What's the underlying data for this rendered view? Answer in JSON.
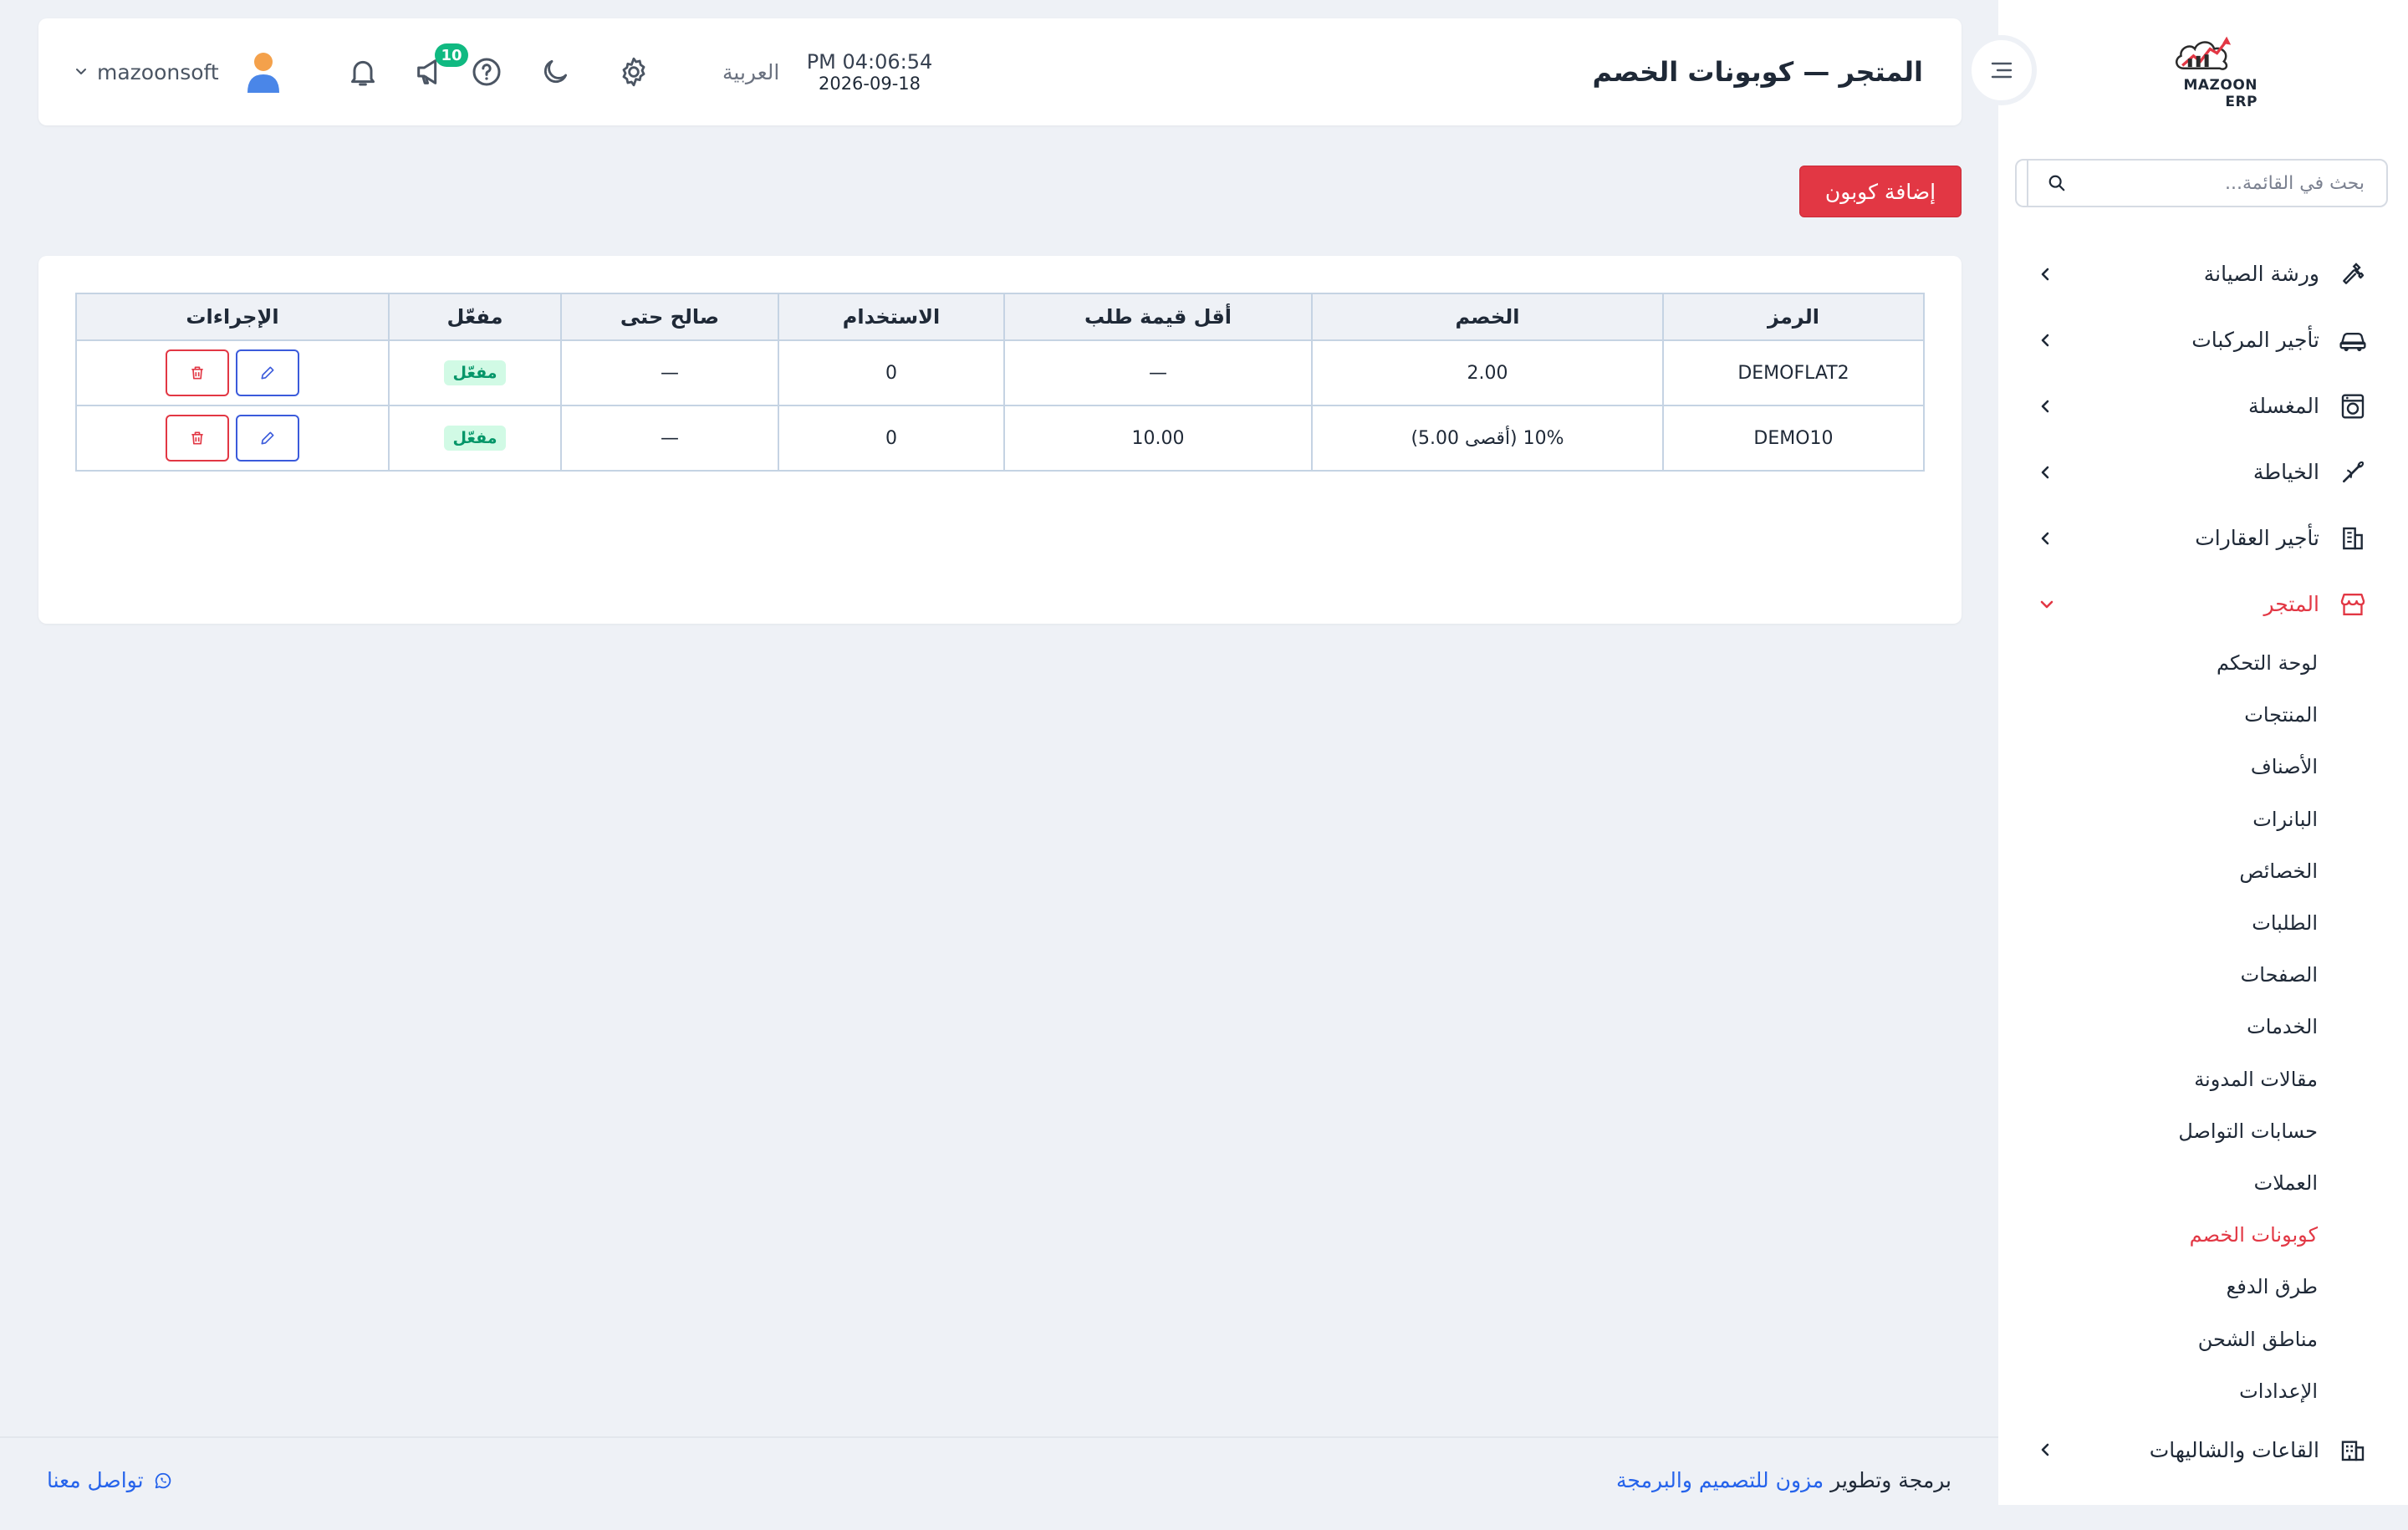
{
  "brand": {
    "logo_text": "MAZOON ERP",
    "accent": "#e23744"
  },
  "sidebar": {
    "search_placeholder": "بحث في القائمة...",
    "items": [
      {
        "label": "ورشة الصيانة",
        "icon": "wrench-icon"
      },
      {
        "label": "تأجير المركبات",
        "icon": "car-icon"
      },
      {
        "label": "المغسلة",
        "icon": "washing-machine-icon"
      },
      {
        "label": "الخياطة",
        "icon": "needle-icon"
      },
      {
        "label": "تأجير العقارات",
        "icon": "building-icon"
      },
      {
        "label": "المتجر",
        "icon": "store-icon",
        "expanded": true
      },
      {
        "label": "القاعات والشاليهات",
        "icon": "hall-icon"
      }
    ],
    "store_submenu": [
      "لوحة التحكم",
      "المنتجات",
      "الأصناف",
      "البانرات",
      "الخصائص",
      "الطلبات",
      "الصفحات",
      "الخدمات",
      "مقالات المدونة",
      "حسابات التواصل",
      "العملات",
      "كوبونات الخصم",
      "طرق الدفع",
      "مناطق الشحن",
      "الإعدادات"
    ],
    "active_submenu": "كوبونات الخصم"
  },
  "header": {
    "title": "المتجر — كوبونات الخصم",
    "time": "PM 04:06:54",
    "date": "2026-09-18",
    "language": "العربية",
    "notification_count": "10",
    "username": "mazoonsoft"
  },
  "toolbar": {
    "add_label": "إضافة كوبون"
  },
  "table": {
    "headers": [
      "الرمز",
      "الخصم",
      "أقل قيمة طلب",
      "الاستخدام",
      "صالح حتى",
      "مفعّل",
      "الإجراءات"
    ],
    "rows": [
      {
        "code": "DEMOFLAT2",
        "discount": "2.00",
        "min_order": "—",
        "usage": "0",
        "valid_until": "—",
        "status": "مفعّل"
      },
      {
        "code": "DEMO10",
        "discount": "10% (أقصى 5.00)",
        "min_order": "10.00",
        "usage": "0",
        "valid_until": "—",
        "status": "مفعّل"
      }
    ]
  },
  "footer": {
    "credit_prefix": "برمجة وتطوير",
    "credit_link": "مزون للتصميم والبرمجة",
    "contact": "تواصل معنا"
  }
}
